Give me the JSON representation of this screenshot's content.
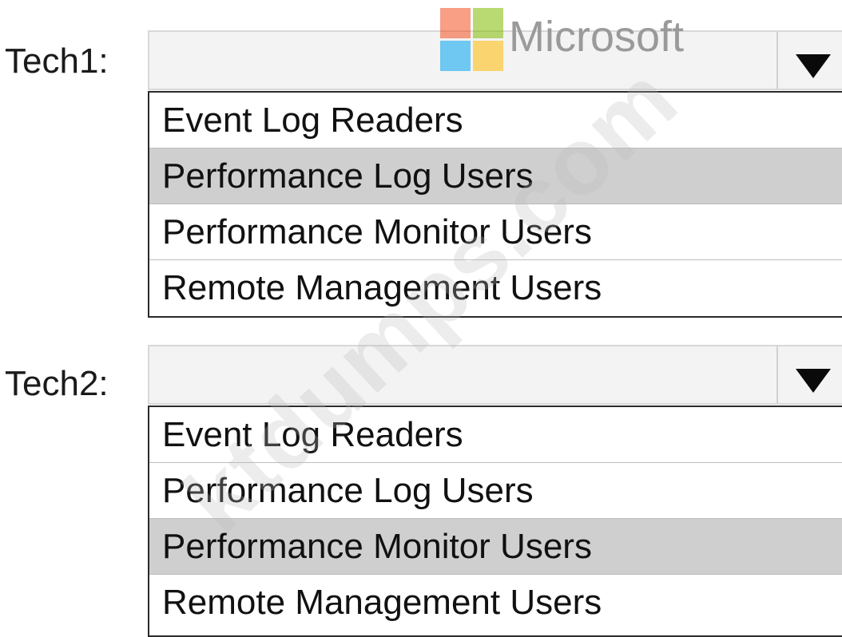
{
  "logo": {
    "text": "Microsoft",
    "colors": {
      "top_left": "#f25022",
      "top_right": "#7fba00",
      "bottom_left": "#00a4ef",
      "bottom_right": "#ffb900"
    }
  },
  "watermark": {
    "text": "ktdumps.com"
  },
  "groups": [
    {
      "label": "Tech1:",
      "dropdown": {
        "selected_value": "",
        "arrow_icon": "chevron-down-icon"
      },
      "options": [
        "Event Log Readers",
        "Performance Log Users",
        "Performance Monitor Users",
        "Remote Management Users"
      ],
      "highlighted_option": "Performance Log Users"
    },
    {
      "label": "Tech2:",
      "dropdown": {
        "selected_value": "",
        "arrow_icon": "chevron-down-icon"
      },
      "options": [
        "Event Log Readers",
        "Performance Log Users",
        "Performance Monitor Users",
        "Remote Management Users"
      ],
      "highlighted_option": "Performance Monitor Users"
    }
  ],
  "colors": {
    "highlight": "#cfcfcf",
    "dropdown_background": "#f3f3f3",
    "list_border": "#2a2a2a"
  }
}
